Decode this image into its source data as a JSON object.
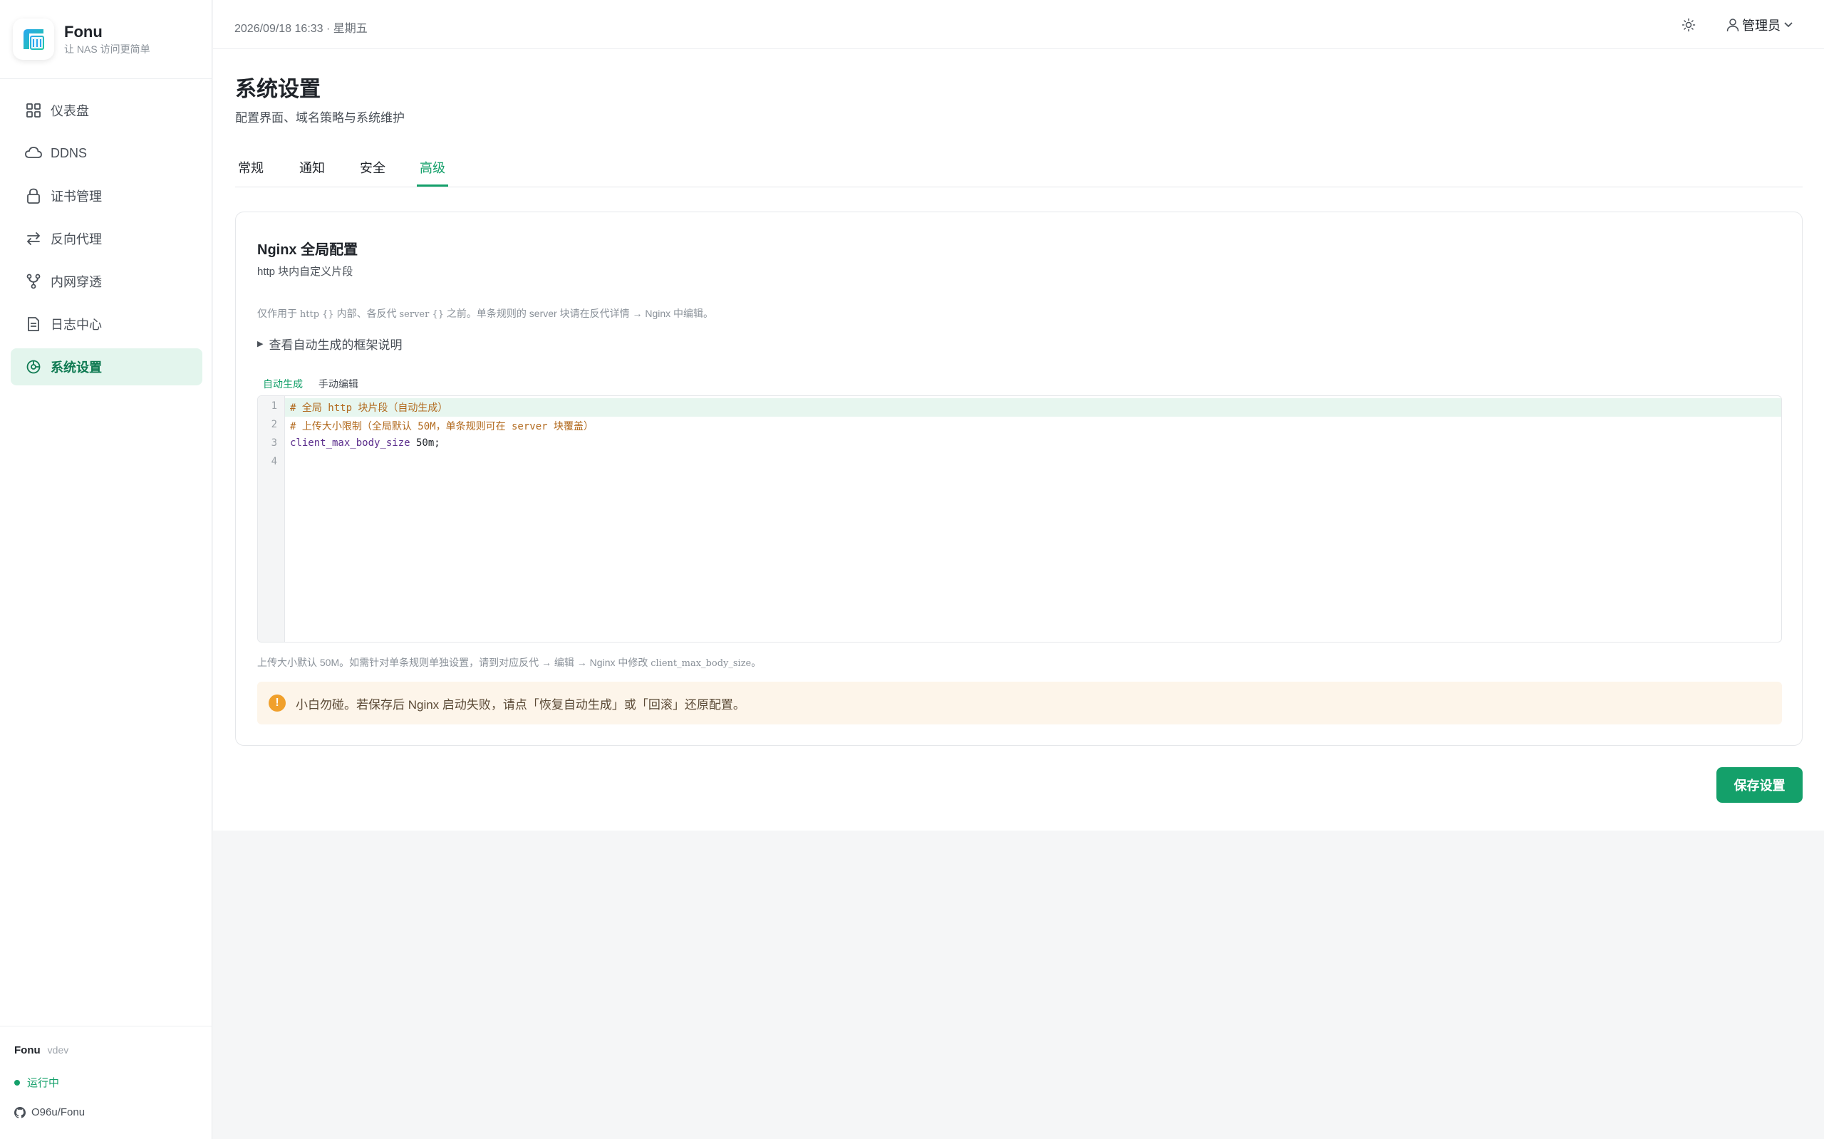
{
  "brand": {
    "name": "Fonu",
    "tagline": "让 NAS 访问更简单"
  },
  "sidebar": {
    "items": [
      {
        "label": "仪表盘",
        "icon": "dashboard-icon",
        "active": false
      },
      {
        "label": "DDNS",
        "icon": "cloud-icon",
        "active": false
      },
      {
        "label": "证书管理",
        "icon": "lock-icon",
        "active": false
      },
      {
        "label": "反向代理",
        "icon": "swap-arrows-icon",
        "active": false
      },
      {
        "label": "内网穿透",
        "icon": "fork-icon",
        "active": false
      },
      {
        "label": "日志中心",
        "icon": "document-icon",
        "active": false
      },
      {
        "label": "系统设置",
        "icon": "settings-icon",
        "active": true
      }
    ],
    "footer": {
      "name": "Fonu",
      "version": "vdev",
      "status": "运行中",
      "repo": "O96u/Fonu"
    }
  },
  "topbar": {
    "datetime": "2026/09/18 16:33 · 星期五",
    "user": "管理员"
  },
  "page": {
    "title": "系统设置",
    "subtitle": "配置界面、域名策略与系统维护"
  },
  "tabs": [
    "常规",
    "通知",
    "安全",
    "高级"
  ],
  "active_tab": "高级",
  "card": {
    "title": "Nginx 全局配置",
    "subtitle": "http 块内自定义片段",
    "note_pre": "仅作用于 ",
    "note_code1": "http {}",
    "note_mid": " 内部、各反代 ",
    "note_code2": "server {}",
    "note_post": " 之前。单条规则的 server 块请在反代详情 → Nginx 中编辑。",
    "details_label": "查看自动生成的框架说明",
    "mode_tabs": [
      "自动生成",
      "手动编辑"
    ],
    "line_numbers": [
      "1",
      "2",
      "3",
      "4"
    ],
    "code": {
      "line1": "# 全局 http 块片段（自动生成）",
      "line2": "# 上传大小限制（全局默认 50M，单条规则可在 server 块覆盖）",
      "line3_prop": "client_max_body_size",
      "line3_val": " 50m;"
    },
    "hint_pre": "上传大小默认 50M。如需针对单条规则单独设置，请到对应反代 → 编辑 → Nginx 中修改 ",
    "hint_code": "client_max_body_size",
    "hint_post": "。",
    "warning": "小白勿碰。若保存后 Nginx 启动失败，请点「恢复自动生成」或「回滚」还原配置。"
  },
  "save_button": "保存设置",
  "colors": {
    "accent": "#14a06a",
    "active_bg": "#e3f5ed",
    "warning_bg": "#fdf5ea",
    "warning_icon": "#f0a02c"
  }
}
